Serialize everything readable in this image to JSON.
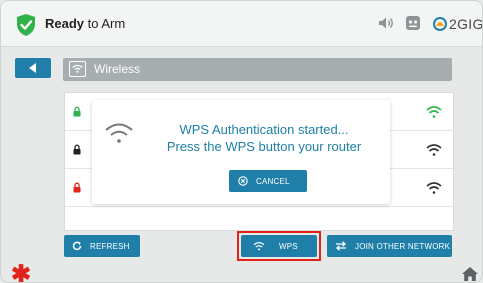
{
  "status": {
    "bold": "Ready",
    "rest": " to Arm",
    "shield_color": "#2fb34a"
  },
  "header": {
    "icons": [
      "moon-icon",
      "speaker-icon",
      "chime-icon",
      "brand-icon"
    ],
    "brand": "2GIG"
  },
  "page": {
    "title": "Wireless"
  },
  "networks": [
    {
      "lock_color": "#2fb34a",
      "wifi_color": "#2fb34a"
    },
    {
      "lock_color": "#222222",
      "wifi_color": "#333333"
    },
    {
      "lock_color": "#e2231a",
      "wifi_color": "#333333"
    }
  ],
  "dialog": {
    "line1": "WPS Authentication started...",
    "line2": "Press the WPS button your router",
    "cancel_label": "CANCEL"
  },
  "buttons": {
    "refresh": "REFRESH",
    "wps": "WPS",
    "join": "JOIN OTHER NETWORK"
  },
  "colors": {
    "accent": "#1f7fa8",
    "highlight": "#e2231a"
  }
}
